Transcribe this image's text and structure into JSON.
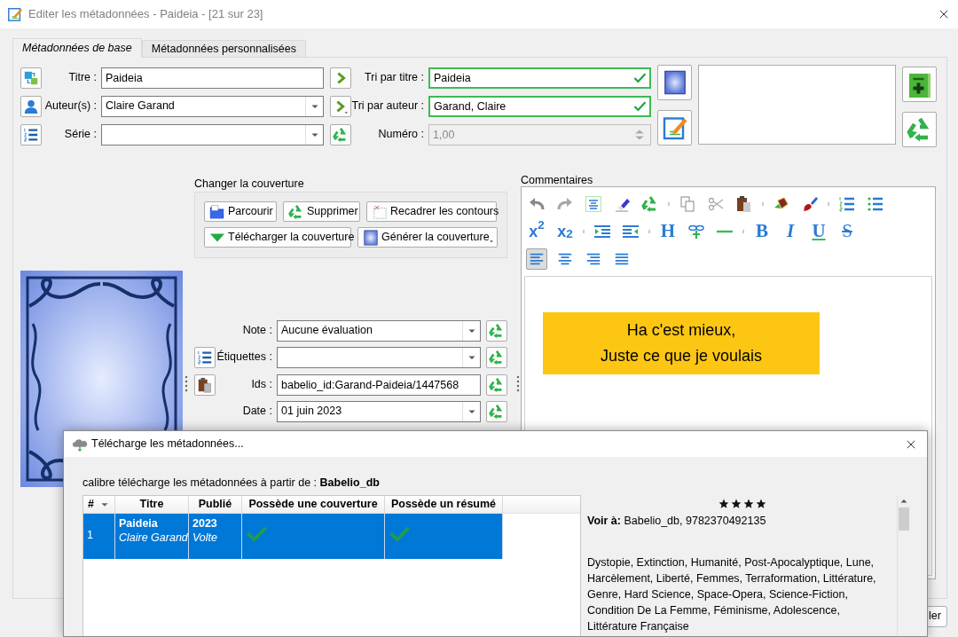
{
  "window": {
    "title": "Editer les métadonnées - Paideia -  [21 sur 23]"
  },
  "tabs": [
    {
      "label": "Métadonnées de base",
      "selected": true
    },
    {
      "label": "Métadonnées personnalisées",
      "selected": false
    }
  ],
  "top_rows": [
    {
      "label": "Titre :",
      "kind": "text",
      "value": "Paideia",
      "right": {
        "kind": "sort",
        "label": "Tri par titre :",
        "value": "Paideia",
        "valid": true
      }
    },
    {
      "label": "Auteur(s) :",
      "kind": "combo",
      "value": "Claire Garand",
      "right": {
        "kind": "sort",
        "label": "Tri par auteur :",
        "value": "Garand, Claire",
        "valid": true
      }
    },
    {
      "label": "Série :",
      "kind": "combo",
      "right": {
        "kind": "spin",
        "label": "Numéro :",
        "value": "1,00",
        "disabled": true
      }
    }
  ],
  "cover": {
    "heading": "Changer la couverture",
    "buttons": [
      {
        "label": "Parcourir"
      },
      {
        "label": "Supprimer"
      },
      {
        "label": "Recadrer les contours"
      },
      {
        "label": "Télécharger la couverture"
      },
      {
        "label": "Générer la couverture",
        "menu": true
      }
    ]
  },
  "lower_fields": [
    {
      "label": "Note :",
      "kind": "combo",
      "value": "Aucune évaluation"
    },
    {
      "label": "Étiquettes :",
      "kind": "combo"
    },
    {
      "label": "Ids :",
      "kind": "text",
      "value": "babelio_id:Garand-Paideia/1447568"
    },
    {
      "label": "Date :",
      "kind": "combo",
      "value": "01 juin 2023"
    }
  ],
  "comments": {
    "label": "Commentaires",
    "toolbar_labels": [
      "x$^{2}$",
      "x$_{2}$",
      "H",
      "B",
      "I",
      "U",
      "S"
    ],
    "align": [
      {
        "selected": true
      },
      {
        "selected": false
      },
      {
        "selected": false
      },
      {
        "selected": false
      }
    ],
    "lines": [
      "Ha c'est mieux,",
      "Juste ce que je voulais"
    ]
  },
  "footer_button": {
    "label": "ler"
  },
  "dialog": {
    "title": "Télécharge les métadonnées...",
    "source": "calibre télécharge les métadonnées à partir de : **Babelio_db**",
    "columns": [
      {
        "label": "#",
        "sorted": true
      },
      {
        "label": "Titre",
        "sorted": false
      },
      {
        "label": "Publié",
        "sorted": false
      },
      {
        "label": "Possède une couverture",
        "sorted": false
      },
      {
        "label": "Possède un résumé",
        "sorted": false
      }
    ],
    "rows": [
      {
        "number": "1",
        "title": "Paideia",
        "author": "Claire Garand",
        "year": "2023",
        "publisher": "Volte",
        "has_cover": true,
        "has_summary": true,
        "selected": true
      }
    ],
    "details": {
      "stars": 4,
      "see_at": {
        "label": "Voir à:",
        "links": [
          "Babelio_db",
          "9782370492135"
        ],
        "separator": ", "
      },
      "tags": "Dystopie, Extinction, Humanité, Post-Apocalyptique, Lune, Harcèlement, Liberté, Femmes, Terraformation, Littérature, Genre, Hard Science, Space-Opera, Science-Fiction, Condition De La Femme, Féminisme, Adolescence, Littérature Française"
    }
  }
}
